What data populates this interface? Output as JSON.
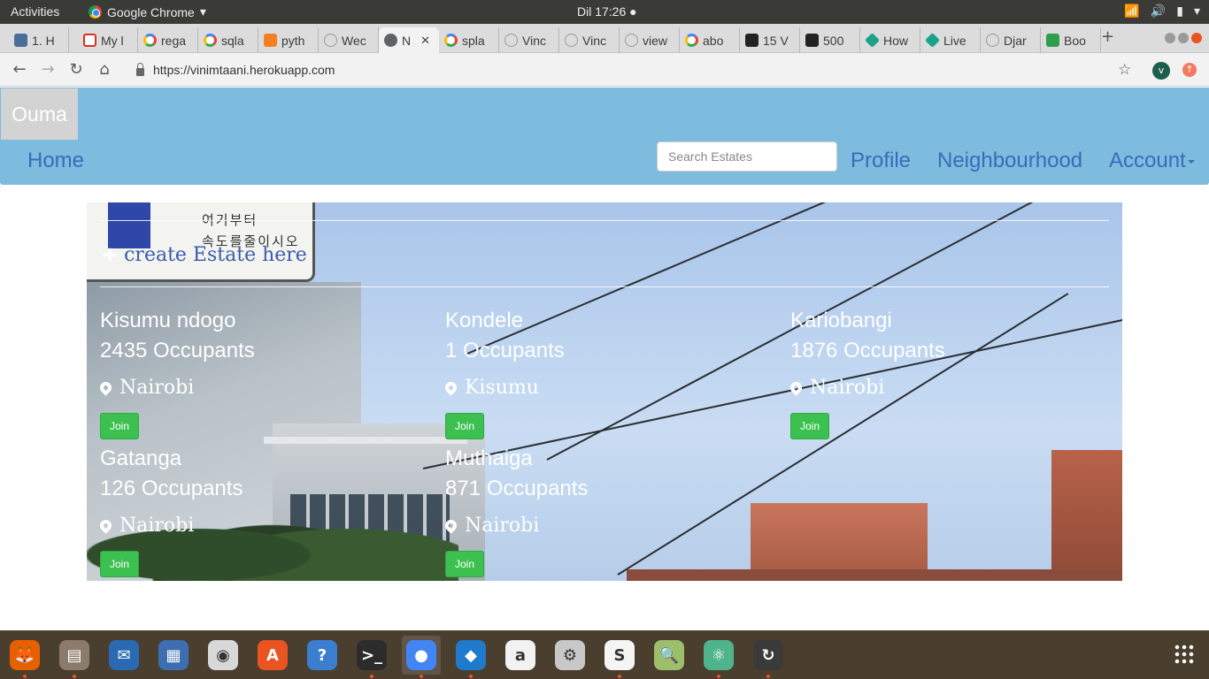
{
  "system_bar": {
    "activities": "Activities",
    "app_name": "Google Chrome",
    "clock": "Dil 17:26"
  },
  "tabs": [
    {
      "title": "1. H",
      "icon": "book-icon"
    },
    {
      "title": "My l",
      "icon": "gmail-icon"
    },
    {
      "title": "rega",
      "icon": "google-icon"
    },
    {
      "title": "sqla",
      "icon": "google-icon"
    },
    {
      "title": "pyth",
      "icon": "stackoverflow-icon"
    },
    {
      "title": "Wec",
      "icon": "blank-icon"
    },
    {
      "title": "N",
      "icon": "globe-icon",
      "active": true
    },
    {
      "title": "spla",
      "icon": "google-icon"
    },
    {
      "title": "Vinc",
      "icon": "blank-icon"
    },
    {
      "title": "Vinc",
      "icon": "blank-icon"
    },
    {
      "title": "view",
      "icon": "blank-icon"
    },
    {
      "title": "abo",
      "icon": "google-icon"
    },
    {
      "title": "15 V",
      "icon": "dark-icon"
    },
    {
      "title": "500",
      "icon": "dark-icon"
    },
    {
      "title": "How",
      "icon": "teal-icon"
    },
    {
      "title": "Live",
      "icon": "teal-icon"
    },
    {
      "title": "Djar",
      "icon": "blank-icon"
    },
    {
      "title": "Boo",
      "icon": "green-icon"
    }
  ],
  "omnibox": {
    "url": "https://vinimtaani.herokuapp.com",
    "avatar_letter": "v"
  },
  "site": {
    "brand": "Ouma",
    "nav_home": "Home",
    "search_placeholder": "Search Estates",
    "nav_profile": "Profile",
    "nav_neighbourhood": "Neighbourhood",
    "nav_account": "Account",
    "create_link": "create Estate here",
    "join_label": "Join",
    "sign_text_line1": "여기부터",
    "sign_text_line2": "속도를줄이시오",
    "estates": [
      {
        "name": "Kisumu ndogo",
        "occupants": "2435 Occupants",
        "location": "Nairobi"
      },
      {
        "name": "Kondele",
        "occupants": "1 Occupants",
        "location": "Kisumu"
      },
      {
        "name": "Kariobangi",
        "occupants": "1876 Occupants",
        "location": "Nairobi"
      },
      {
        "name": "Gatanga",
        "occupants": "126 Occupants",
        "location": "Nairobi"
      },
      {
        "name": "Muthaiga",
        "occupants": "871 Occupants",
        "location": "Nairobi"
      }
    ]
  },
  "dock": [
    {
      "name": "firefox-icon",
      "color": "#e66000"
    },
    {
      "name": "files-icon",
      "color": "#8c7b6b"
    },
    {
      "name": "thunderbird-icon",
      "color": "#2a6ab3"
    },
    {
      "name": "document-viewer-icon",
      "color": "#3d6fb0"
    },
    {
      "name": "rhythmbox-icon",
      "color": "#d8d8d8"
    },
    {
      "name": "software-center-icon",
      "color": "#e95420"
    },
    {
      "name": "help-icon",
      "color": "#3b7ed0"
    },
    {
      "name": "terminal-icon",
      "color": "#2c2c2c"
    },
    {
      "name": "chrome-icon",
      "color": "#4285f4"
    },
    {
      "name": "vscode-icon",
      "color": "#1f7acb"
    },
    {
      "name": "amazon-icon",
      "color": "#f2f2f2"
    },
    {
      "name": "settings-icon",
      "color": "#c8c8c8"
    },
    {
      "name": "slack-icon",
      "color": "#f5f5f5"
    },
    {
      "name": "image-viewer-icon",
      "color": "#9bbf6a"
    },
    {
      "name": "atom-icon",
      "color": "#4fb48b"
    },
    {
      "name": "updater-icon",
      "color": "#3a3a3a"
    }
  ]
}
